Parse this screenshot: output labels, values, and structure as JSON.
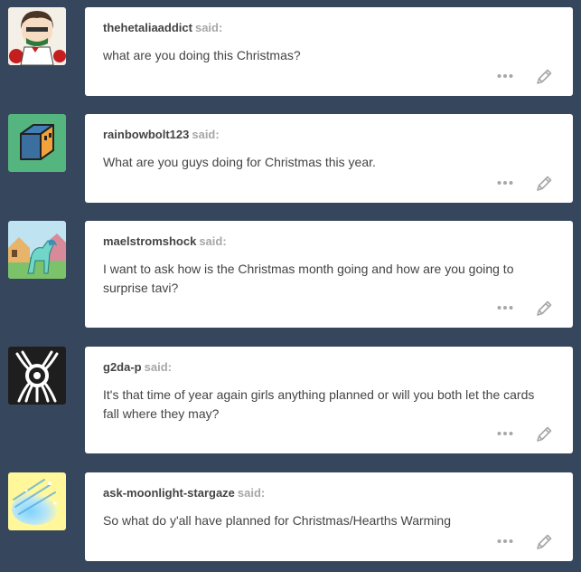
{
  "posts": [
    {
      "username": "thehetaliaaddict",
      "said_label": "said:",
      "text": "what are you doing this Christmas?",
      "avatar_icon": "anime-character-avatar-icon",
      "more_icon": "ellipsis-icon",
      "edit_icon": "pencil-icon"
    },
    {
      "username": "rainbowbolt123",
      "said_label": "said:",
      "text": "What are you guys doing for Christmas this year.",
      "avatar_icon": "orange-cube-avatar-icon",
      "more_icon": "ellipsis-icon",
      "edit_icon": "pencil-icon"
    },
    {
      "username": "maelstromshock",
      "said_label": "said:",
      "text": "I want to ask how is the Christmas month going and how are you going to surprise tavi?",
      "avatar_icon": "pony-scene-avatar-icon",
      "more_icon": "ellipsis-icon",
      "edit_icon": "pencil-icon"
    },
    {
      "username": "g2da-p",
      "said_label": "said:",
      "text": "It's that time of year again girls anything planned or will you both let the cards fall where they may?",
      "avatar_icon": "emblem-eye-avatar-icon",
      "more_icon": "ellipsis-icon",
      "edit_icon": "pencil-icon"
    },
    {
      "username": "ask-moonlight-stargaze",
      "said_label": "said:",
      "text": "So what do y'all have planned for Christmas/Hearths Warming",
      "avatar_icon": "starry-sky-avatar-icon",
      "more_icon": "ellipsis-icon",
      "edit_icon": "pencil-icon"
    }
  ],
  "colors": {
    "page_background": "#36465d",
    "card_background": "#ffffff",
    "text": "#444444",
    "said_text": "#a7a7a7",
    "icon": "#a7a7a7"
  }
}
